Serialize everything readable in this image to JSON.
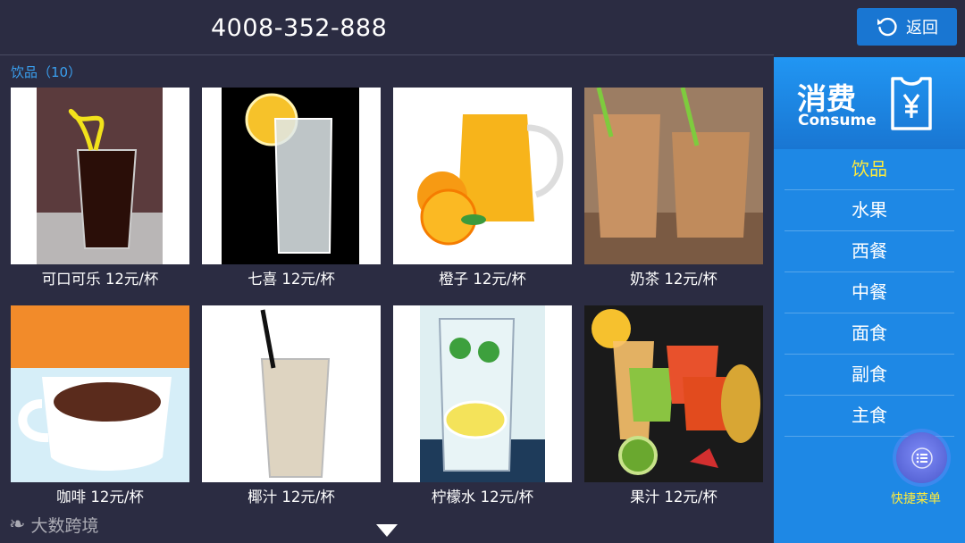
{
  "header": {
    "phone": "4008-352-888",
    "back_label": "返回"
  },
  "category_header": "饮品（10）",
  "products": [
    {
      "name": "可口可乐 12元/杯",
      "image": "cola-glass"
    },
    {
      "name": "七喜 12元/杯",
      "image": "soda-glass-lemon"
    },
    {
      "name": "橙子 12元/杯",
      "image": "orange-juice-pitcher"
    },
    {
      "name": "奶茶 12元/杯",
      "image": "milk-tea-glasses"
    },
    {
      "name": "咖啡 12元/杯",
      "image": "cocoa-cup"
    },
    {
      "name": "椰汁 12元/杯",
      "image": "coconut-milk-glass"
    },
    {
      "name": "柠檬水 12元/杯",
      "image": "lemon-water-glass"
    },
    {
      "name": "果汁 12元/杯",
      "image": "fruit-juices"
    }
  ],
  "sidebar": {
    "title": "消费",
    "subtitle": "Consume",
    "menu": [
      {
        "label": "饮品",
        "active": true
      },
      {
        "label": "水果",
        "active": false
      },
      {
        "label": "西餐",
        "active": false
      },
      {
        "label": "中餐",
        "active": false
      },
      {
        "label": "面食",
        "active": false
      },
      {
        "label": "副食",
        "active": false
      },
      {
        "label": "主食",
        "active": false
      }
    ],
    "quick_menu_label": "快捷菜单"
  },
  "watermark": "大数跨境",
  "colors": {
    "background": "#2b2c42",
    "accent": "#1e88e5",
    "active_menu": "#ffeb3b",
    "category_header": "#3aa0f0"
  }
}
